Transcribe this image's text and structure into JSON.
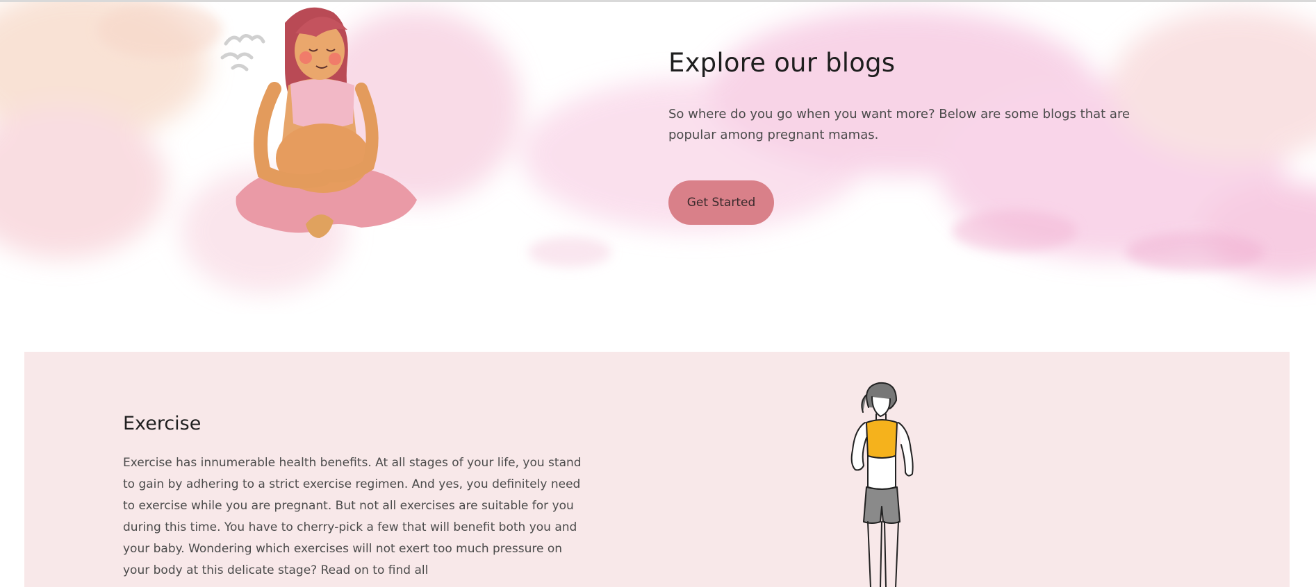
{
  "hero": {
    "title": "Explore our blogs",
    "description": "So where do you go when you want more? Below are some blogs that are popular among pregnant mamas.",
    "cta_label": "Get Started",
    "illustration": "pregnant-woman-meditating-illustration"
  },
  "exercise": {
    "title": "Exercise",
    "body": "Exercise has innumerable health benefits. At all stages of your life, you stand to gain by adhering to a strict exercise regimen. And yes, you definitely need to exercise while you are pregnant. But not all exercises are suitable for you during this time. You have to cherry-pick a few that will benefit both you and your baby. Wondering which exercises will not exert too much pressure on your body at this delicate stage? Read on to find all",
    "illustration": "woman-athlete-illustration"
  },
  "colors": {
    "button": "#d98089",
    "card_background": "#f8e8e9",
    "wash_pink": "#f5c8dc",
    "wash_peach": "#f7d9c8"
  }
}
